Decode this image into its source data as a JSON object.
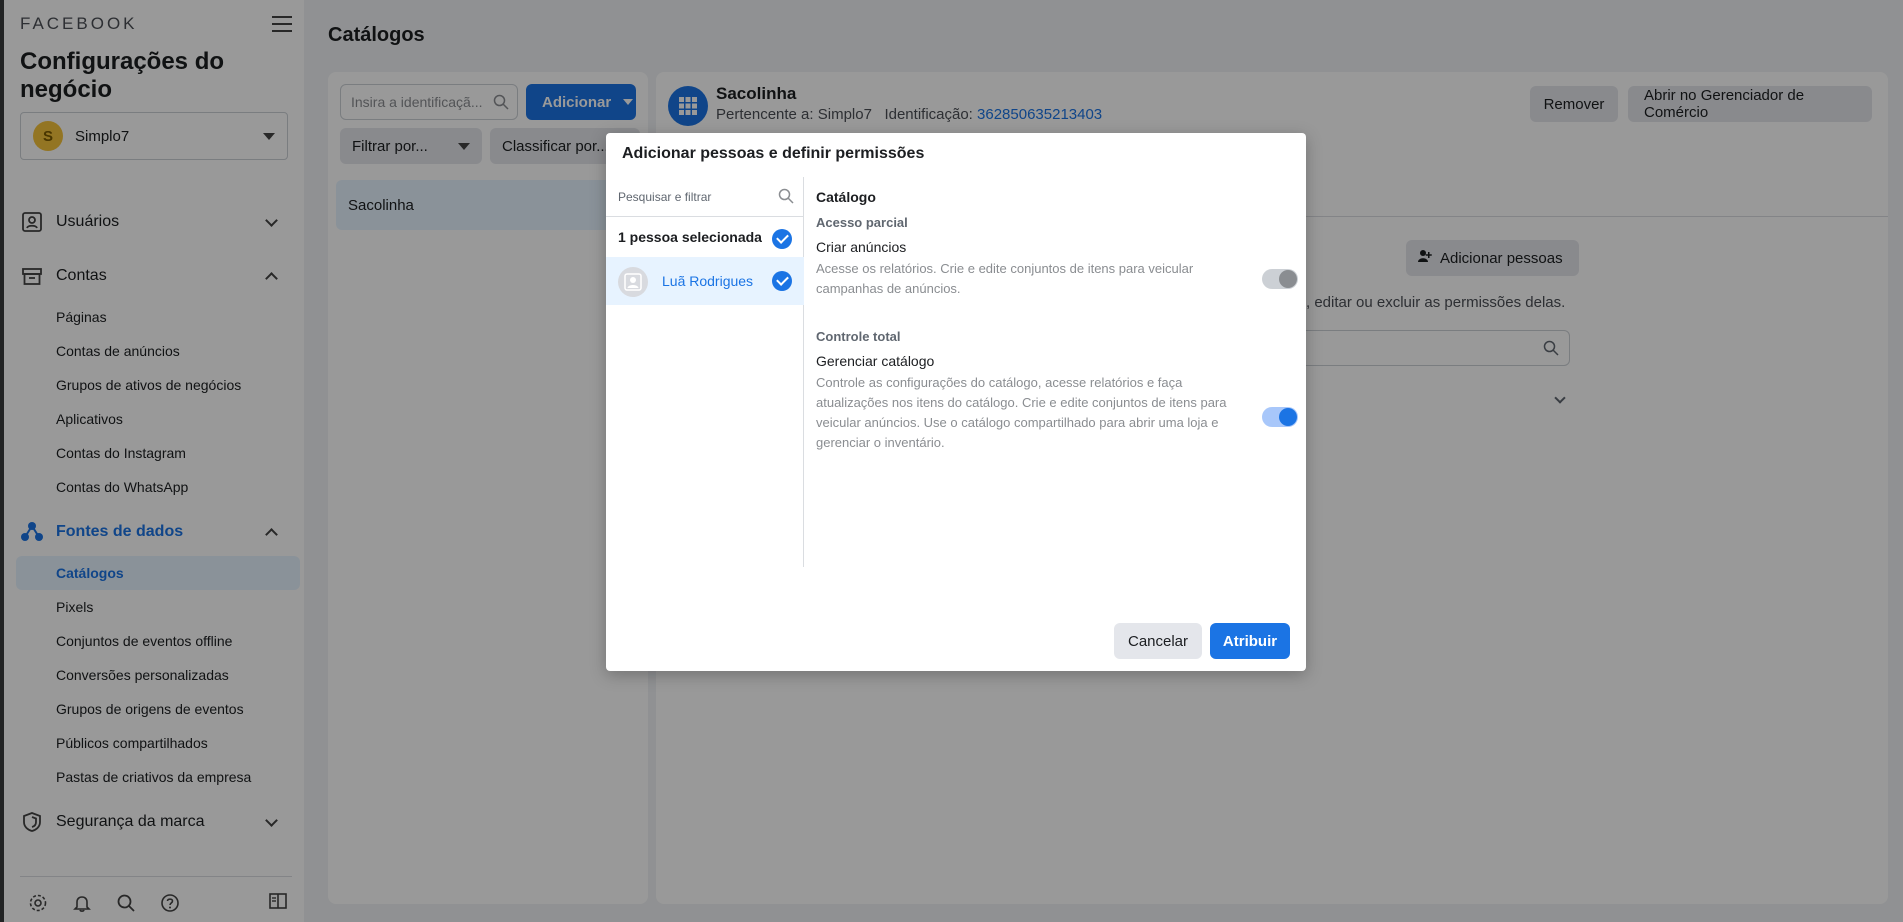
{
  "sidebar": {
    "logo": "FACEBOOK",
    "business_title": "Configurações do negócio",
    "account": {
      "initial": "S",
      "name": "Simplo7"
    },
    "sections": {
      "usuarios": "Usuários",
      "contas": "Contas",
      "fontes": "Fontes de dados",
      "seguranca": "Segurança da marca"
    },
    "contas_items": [
      "Páginas",
      "Contas de anúncios",
      "Grupos de ativos de negócios",
      "Aplicativos",
      "Contas do Instagram",
      "Contas do WhatsApp"
    ],
    "fontes_items": [
      "Catálogos",
      "Pixels",
      "Conjuntos de eventos offline",
      "Conversões personalizadas",
      "Grupos de origens de eventos",
      "Públicos compartilhados",
      "Pastas de criativos da empresa"
    ]
  },
  "main": {
    "title": "Catálogos",
    "search_placeholder": "Insira a identificaçã...",
    "add_label": "Adicionar",
    "filter_label": "Filtrar por...",
    "sort_label": "Classificar por...",
    "list_items": [
      "Sacolinha"
    ]
  },
  "detail": {
    "name": "Sacolinha",
    "owner_label": "Pertencente a: Simplo7",
    "id_label": "Identificação:",
    "id_value": "362850635213403",
    "remove_label": "Remover",
    "commerce_label": "Abrir no Gerenciador de Comércio",
    "add_people_label": "Adicionar pessoas",
    "permissions_text": ", editar ou excluir as permissões delas."
  },
  "modal": {
    "title": "Adicionar pessoas e definir permissões",
    "search_placeholder": "Pesquisar e filtrar",
    "selected_count": "1 pessoa selecionada",
    "person_name": "Luã Rodrigues",
    "section_title": "Catálogo",
    "partial_title": "Acesso parcial",
    "partial_perm": "Criar anúncios",
    "partial_desc": "Acesse os relatórios. Crie e edite conjuntos de itens para veicular campanhas de anúncios.",
    "partial_enabled": false,
    "full_title": "Controle total",
    "full_perm": "Gerenciar catálogo",
    "full_desc": "Controle as configurações do catálogo, acesse relatórios e faça atualizações nos itens do catálogo. Crie e edite conjuntos de itens para veicular anúncios. Use o catálogo compartilhado para abrir uma loja e gerenciar o inventário.",
    "full_enabled": true,
    "cancel_label": "Cancelar",
    "assign_label": "Atribuir"
  },
  "colors": {
    "accent": "#1b74e4",
    "overlay": "rgba(0,0,0,0.4)"
  }
}
